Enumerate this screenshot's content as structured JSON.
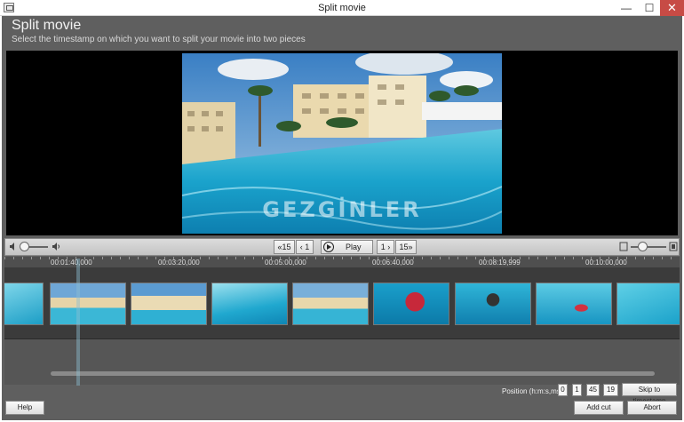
{
  "window": {
    "title": "Split movie",
    "minimize": "—",
    "maximize": "☐",
    "close": "✕"
  },
  "header": {
    "title": "Split movie",
    "subtitle": "Select the timestamp on which you want to split your movie into two pieces"
  },
  "preview": {
    "watermark": "GEZGİNLER"
  },
  "controls": {
    "rewind": "15",
    "step_back": "1",
    "play": "Play",
    "step_forward": "1",
    "forward": "15"
  },
  "timeline": {
    "ticks": [
      "00:01:40,000",
      "00:03:20,000",
      "00:05:00,000",
      "00:06:40,000",
      "00:08:19,999",
      "00:10:00,000"
    ]
  },
  "position": {
    "label": "Position (h:m:s,ms):",
    "hours": "0",
    "minutes": "1",
    "seconds": "45",
    "milliseconds": "19",
    "skip_label": "Skip to timestamp"
  },
  "footer": {
    "help": "Help",
    "add_cut": "Add cut",
    "abort": "Abort"
  }
}
